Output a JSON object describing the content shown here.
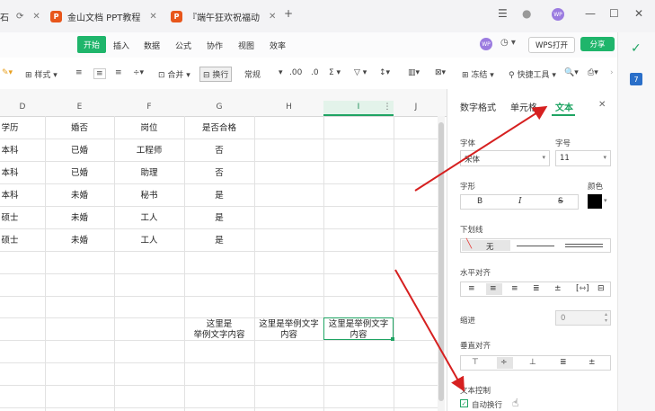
{
  "titlebar": {
    "tabs": [
      {
        "label": "金山文档 PPT教程",
        "icon": "P"
      },
      {
        "label": "『端午狂欢祝福动",
        "icon": "P"
      }
    ],
    "partial_tab": "石"
  },
  "menu": {
    "items": [
      "开始",
      "插入",
      "数据",
      "公式",
      "协作",
      "视图",
      "效率"
    ],
    "active": "开始",
    "avatar": "WP",
    "wps_open": "WPS打开",
    "share": "分享"
  },
  "toolbar": {
    "style": "样式",
    "merge": "合并",
    "wrap": "换行",
    "format": "常规",
    "freeze": "冻结",
    "quick": "快捷工具"
  },
  "grid": {
    "columns": [
      "D",
      "E",
      "F",
      "G",
      "H",
      "I",
      "J"
    ],
    "rows": [
      [
        "学历",
        "婚否",
        "岗位",
        "是否合格"
      ],
      [
        "本科",
        "已婚",
        "工程师",
        "否"
      ],
      [
        "本科",
        "已婚",
        "助理",
        "否"
      ],
      [
        "本科",
        "未婚",
        "秘书",
        "是"
      ],
      [
        "硕士",
        "未婚",
        "工人",
        "是"
      ],
      [
        "硕士",
        "未婚",
        "工人",
        "是"
      ]
    ],
    "g_cell": "这里是\n举例文字内容",
    "h_cell": "这里是举例文字\n内容",
    "i_cell": "这里是举例文字\n内容"
  },
  "panel": {
    "tabs": [
      "数字格式",
      "单元格",
      "文本"
    ],
    "active_tab": "文本",
    "font_label": "字体",
    "size_label": "字号",
    "font_value": "宋体",
    "size_value": "11",
    "style_label": "字形",
    "color_label": "颜色",
    "bold": "B",
    "italic": "I",
    "strike": "S",
    "underline_label": "下划线",
    "underline_none": "无",
    "halign_label": "水平对齐",
    "indent_label": "缩进",
    "indent_value": "0",
    "valign_label": "垂直对齐",
    "textctrl_label": "文本控制",
    "autowrap_label": "自动换行"
  }
}
